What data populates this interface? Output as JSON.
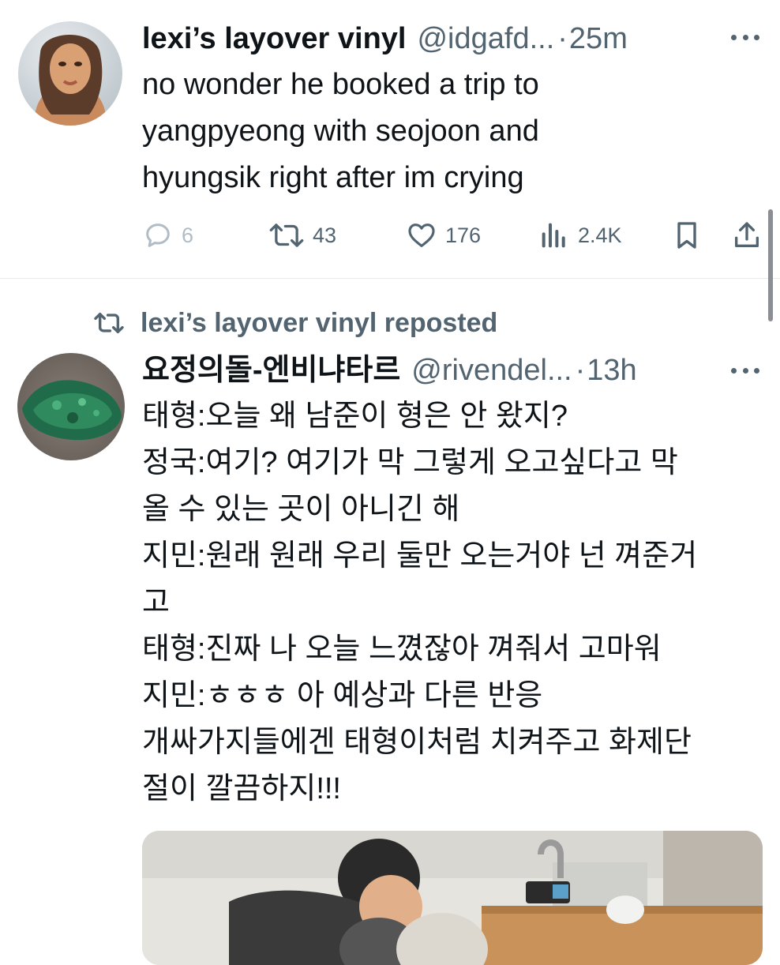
{
  "tweet1": {
    "name": "lexi’s layover vinyl",
    "handle": "@idgafd...",
    "separator": "·",
    "time": "25m",
    "lines": [
      "no wonder he booked a trip to",
      "yangpyeong with seojoon and",
      "hyungsik right after im crying"
    ],
    "stats": {
      "replies": "6",
      "reposts": "43",
      "likes": "176",
      "views": "2.4K"
    }
  },
  "repost_banner": "lexi’s layover vinyl reposted",
  "tweet2": {
    "name": "요정의돌-엔비냐타르",
    "handle": "@rivendel...",
    "separator": "·",
    "time": "13h",
    "lines": [
      "태형:오늘 왜 남준이 형은 안 왔지?",
      "정국:여기? 여기가 막 그렇게 오고싶다고 막",
      "올 수 있는 곳이 아니긴 해",
      "지민:원래 원래 우리 둘만 오는거야 넌 껴준거",
      "고",
      "태형:진짜 나 오늘 느꼈잖아 껴줘서 고마워",
      "지민:ㅎㅎㅎ 아 예상과 다른 반응",
      "개싸가지들에겐 태형이처럼 치켜주고 화제단",
      "절이 깔끔하지!!!"
    ]
  },
  "icons": {
    "reply": "reply-icon",
    "repost": "repost-icon",
    "like": "heart-icon",
    "views": "views-icon",
    "bookmark": "bookmark-icon",
    "share": "share-icon",
    "more": "more-icon"
  },
  "colors": {
    "text": "#0f1419",
    "secondary": "#536471",
    "divider": "#e7e9ea",
    "faint": "#b0bcc6"
  }
}
